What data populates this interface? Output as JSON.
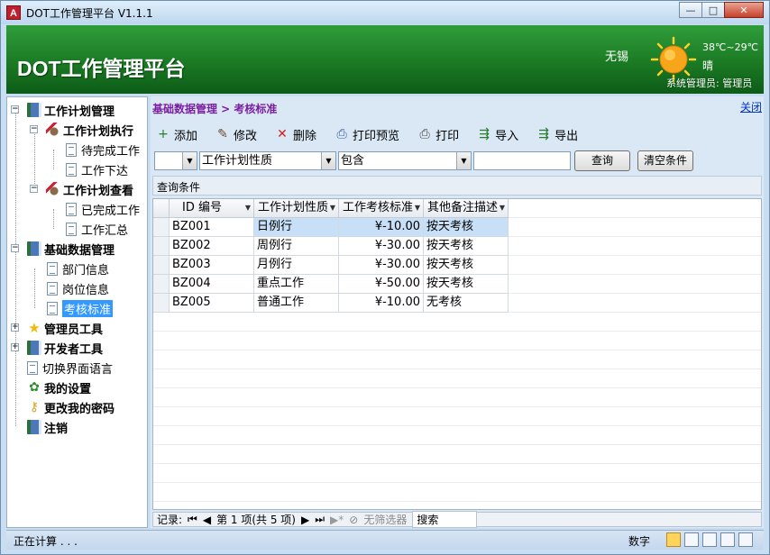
{
  "window": {
    "title": "DOT工作管理平台 V1.1.1",
    "app_icon": "A",
    "minimize": "—",
    "maximize": "□",
    "close": "✕"
  },
  "banner": {
    "title": "DOT工作管理平台",
    "city": "无锡",
    "temperature": "38℃~29℃",
    "weather": "晴",
    "admin": "系统管理员: 管理员"
  },
  "sidebar": {
    "items": [
      {
        "label": "工作计划管理",
        "icon": "book-icon",
        "level": 0,
        "expander": "−"
      },
      {
        "label": "工作计划执行",
        "icon": "tools-icon",
        "level": 1,
        "expander": "−"
      },
      {
        "label": "待完成工作",
        "icon": "document-icon",
        "level": 2
      },
      {
        "label": "工作下达",
        "icon": "document-icon",
        "level": 2
      },
      {
        "label": "工作计划查看",
        "icon": "tools-icon",
        "level": 1,
        "expander": "−"
      },
      {
        "label": "已完成工作",
        "icon": "document-icon",
        "level": 2
      },
      {
        "label": "工作汇总",
        "icon": "document-icon",
        "level": 2
      },
      {
        "label": "基础数据管理",
        "icon": "book-icon",
        "level": 0,
        "expander": "−"
      },
      {
        "label": "部门信息",
        "icon": "document-icon",
        "level": 1
      },
      {
        "label": "岗位信息",
        "icon": "document-icon",
        "level": 1
      },
      {
        "label": "考核标准",
        "icon": "document-icon",
        "level": 1,
        "selected": true
      },
      {
        "label": "管理员工具",
        "icon": "star-icon",
        "level": 0,
        "expander": "+"
      },
      {
        "label": "开发者工具",
        "icon": "book-icon",
        "level": 0,
        "expander": "+"
      },
      {
        "label": "切换界面语言",
        "icon": "document-icon",
        "level": 0
      },
      {
        "label": "我的设置",
        "icon": "settings-icon",
        "level": 0
      },
      {
        "label": "更改我的密码",
        "icon": "key-icon",
        "level": 0
      },
      {
        "label": "注销",
        "icon": "book-icon",
        "level": 0
      }
    ]
  },
  "main": {
    "breadcrumb": "基础数据管理 > 考核标准",
    "close_label": "关闭",
    "toolbar": [
      {
        "label": "添加",
        "icon": "add-icon",
        "glyph": "+"
      },
      {
        "label": "修改",
        "icon": "edit-icon",
        "glyph": "✎"
      },
      {
        "label": "删除",
        "icon": "delete-icon",
        "glyph": "✕"
      },
      {
        "label": "打印预览",
        "icon": "print-preview-icon",
        "glyph": "⎙"
      },
      {
        "label": "打印",
        "icon": "print-icon",
        "glyph": "⎙"
      },
      {
        "label": "导入",
        "icon": "import-icon",
        "glyph": "⇶"
      },
      {
        "label": "导出",
        "icon": "export-icon",
        "glyph": "⇶"
      }
    ],
    "filter": {
      "logic": "",
      "field": "工作计划性质",
      "operator": "包含",
      "value": "",
      "query_button": "查询",
      "clear_button": "清空条件"
    },
    "conditions_label": "查询条件",
    "grid": {
      "columns": [
        "ID 编号",
        "工作计划性质",
        "工作考核标准",
        "其他备注描述"
      ],
      "rows": [
        [
          "BZ001",
          "日例行",
          "¥-10.00",
          "按天考核"
        ],
        [
          "BZ002",
          "周例行",
          "¥-30.00",
          "按天考核"
        ],
        [
          "BZ003",
          "月例行",
          "¥-30.00",
          "按天考核"
        ],
        [
          "BZ004",
          "重点工作",
          "¥-50.00",
          "按天考核"
        ],
        [
          "BZ005",
          "普通工作",
          "¥-10.00",
          "无考核"
        ]
      ]
    },
    "navigator": {
      "records_label": "记录:",
      "position": "第 1 项(共 5 项)",
      "no_filter": "无筛选器",
      "search": "搜索"
    }
  },
  "status": {
    "left": "正在计算 . . .",
    "right": "数字"
  },
  "colors": {
    "banner": "#1b7a24",
    "breadcrumb": "#7a1fa2",
    "selection": "#3399ff"
  }
}
